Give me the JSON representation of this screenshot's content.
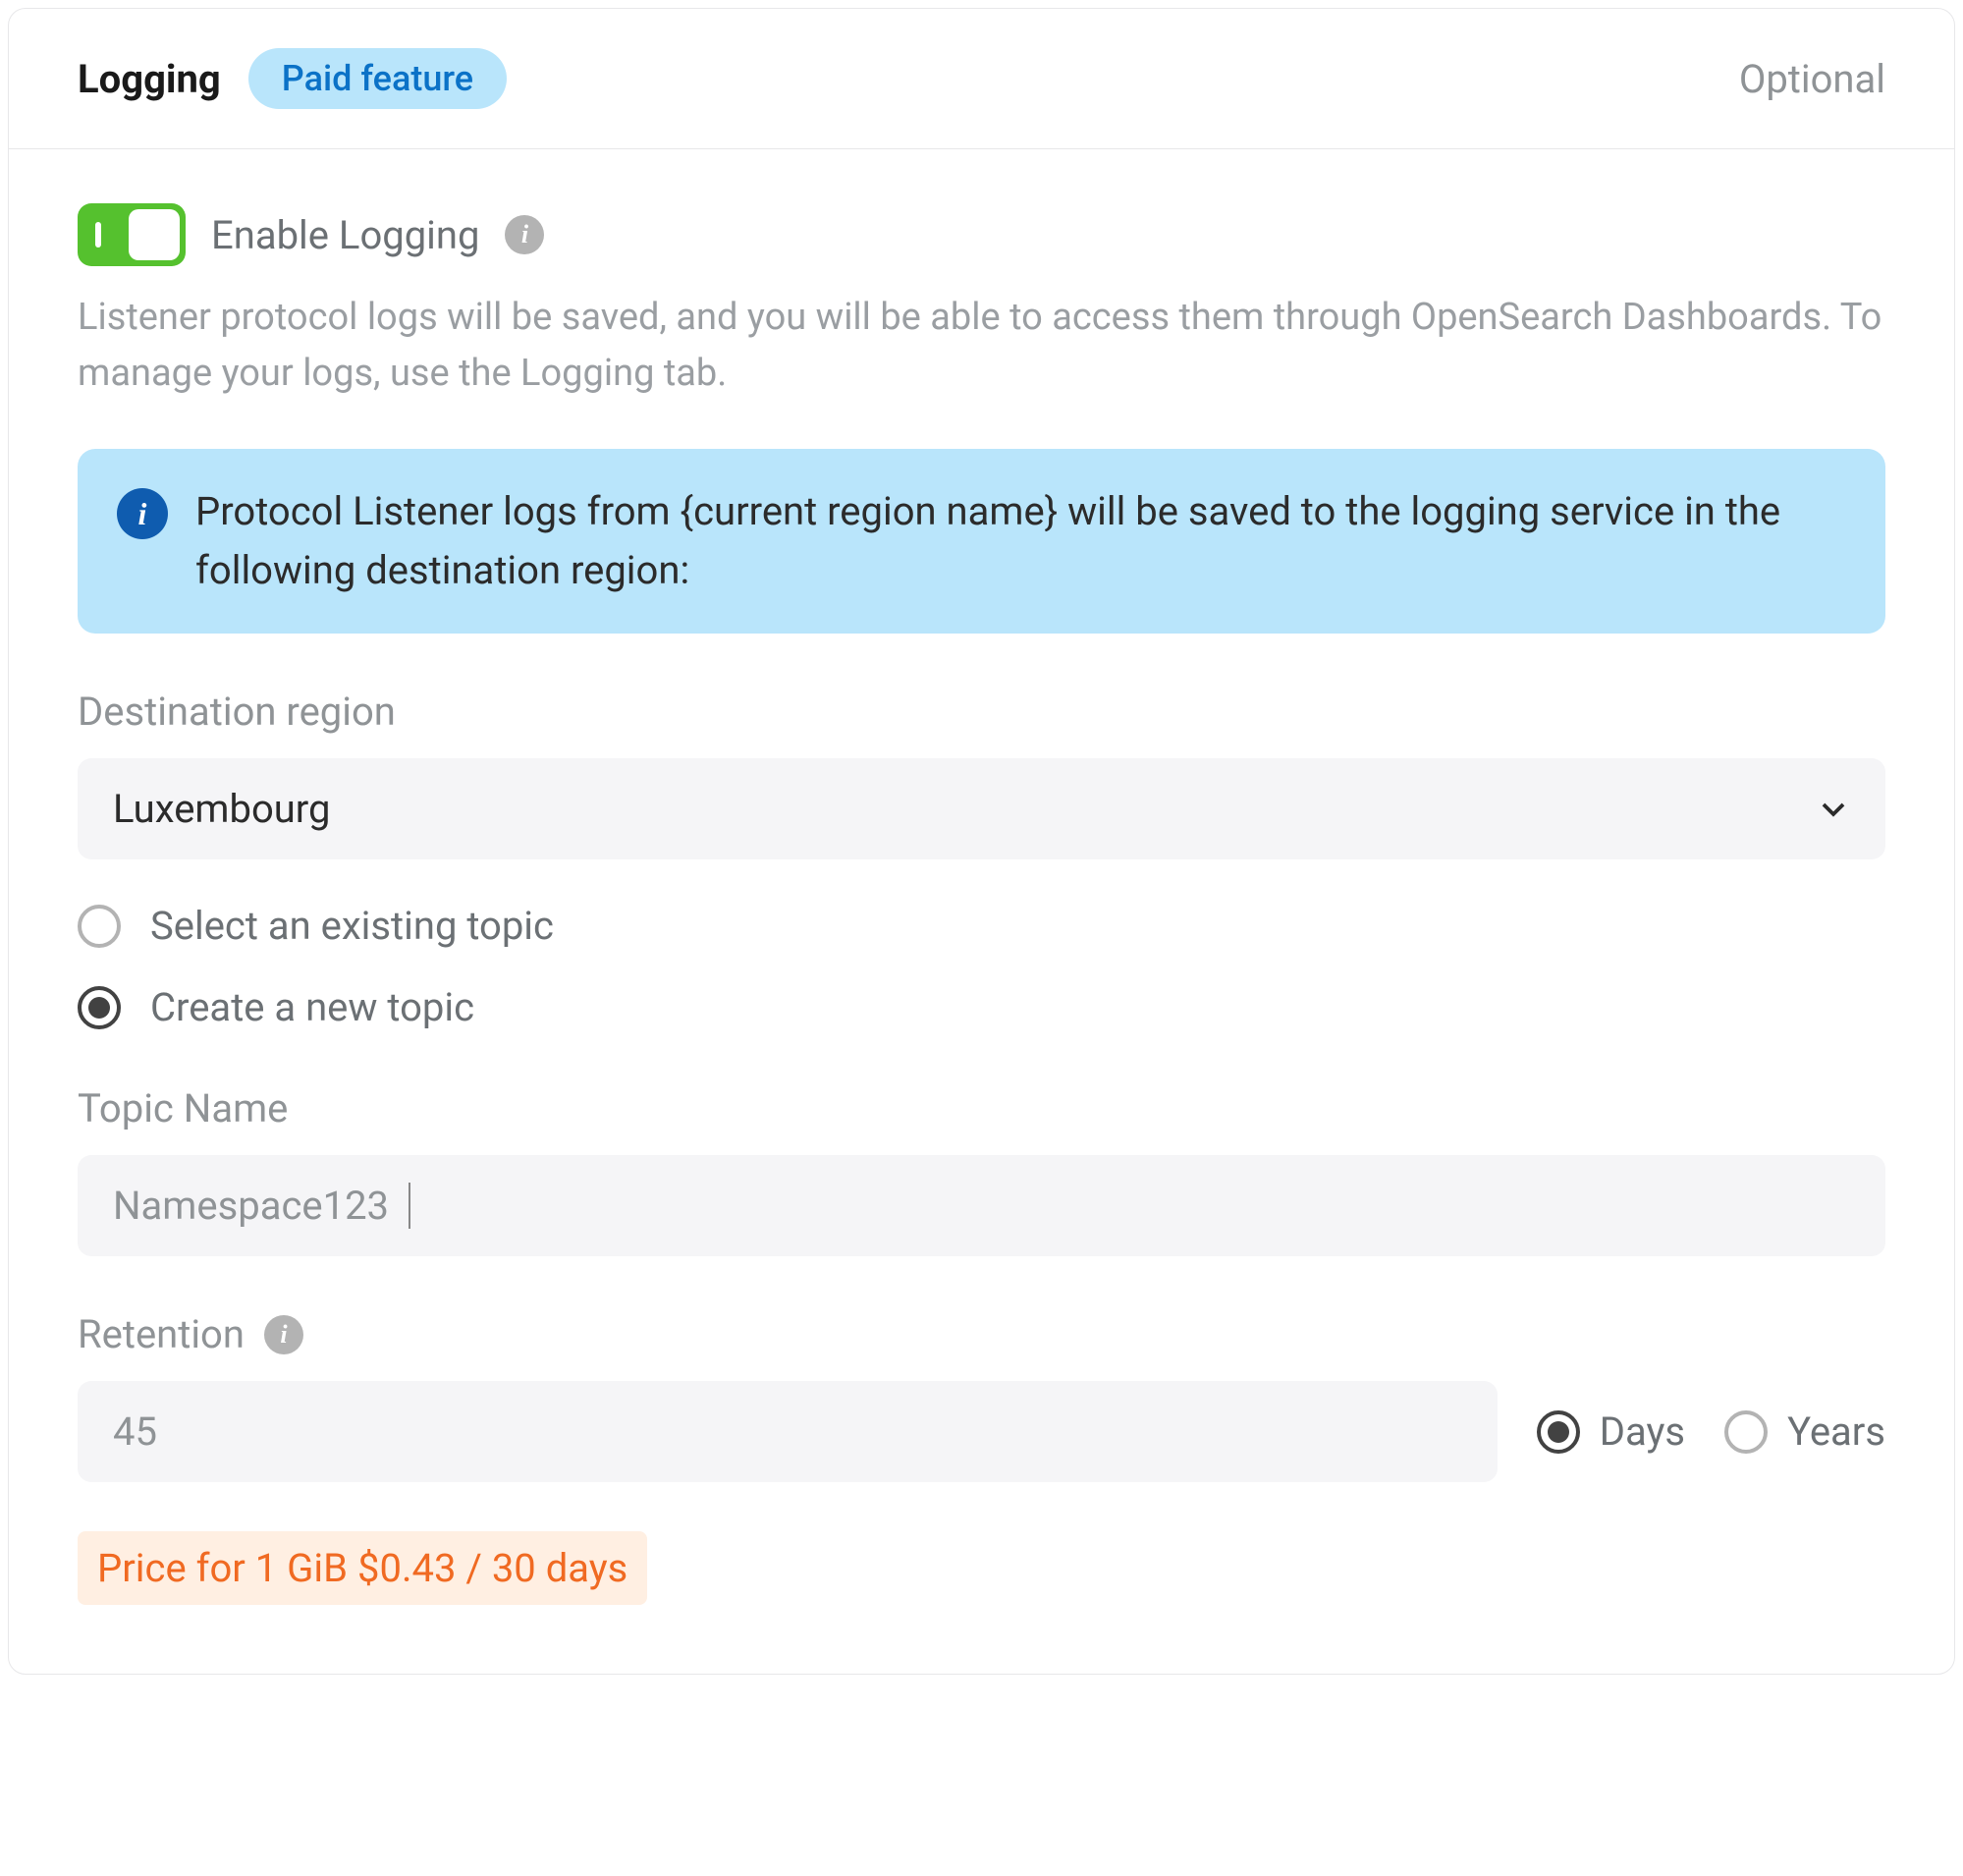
{
  "header": {
    "title": "Logging",
    "badge": "Paid feature",
    "optional": "Optional"
  },
  "toggle": {
    "label": "Enable Logging",
    "enabled": true
  },
  "description": "Listener protocol logs will be saved, and you will be able to access them through OpenSearch Dashboards. To manage your logs, use the Logging tab.",
  "alert": {
    "text": "Protocol Listener logs from {current region name} will be saved to the logging service in the following destination region:"
  },
  "destination": {
    "label": "Destination region",
    "value": "Luxembourg"
  },
  "topic_mode": {
    "options": [
      {
        "label": "Select an existing topic",
        "checked": false
      },
      {
        "label": "Create a new topic",
        "checked": true
      }
    ]
  },
  "topic_name": {
    "label": "Topic Name",
    "value": "Namespace123"
  },
  "retention": {
    "label": "Retention",
    "value": "45",
    "units": [
      {
        "label": "Days",
        "checked": true
      },
      {
        "label": "Years",
        "checked": false
      }
    ]
  },
  "price": "Price for 1 GiB $0.43 / 30 days"
}
